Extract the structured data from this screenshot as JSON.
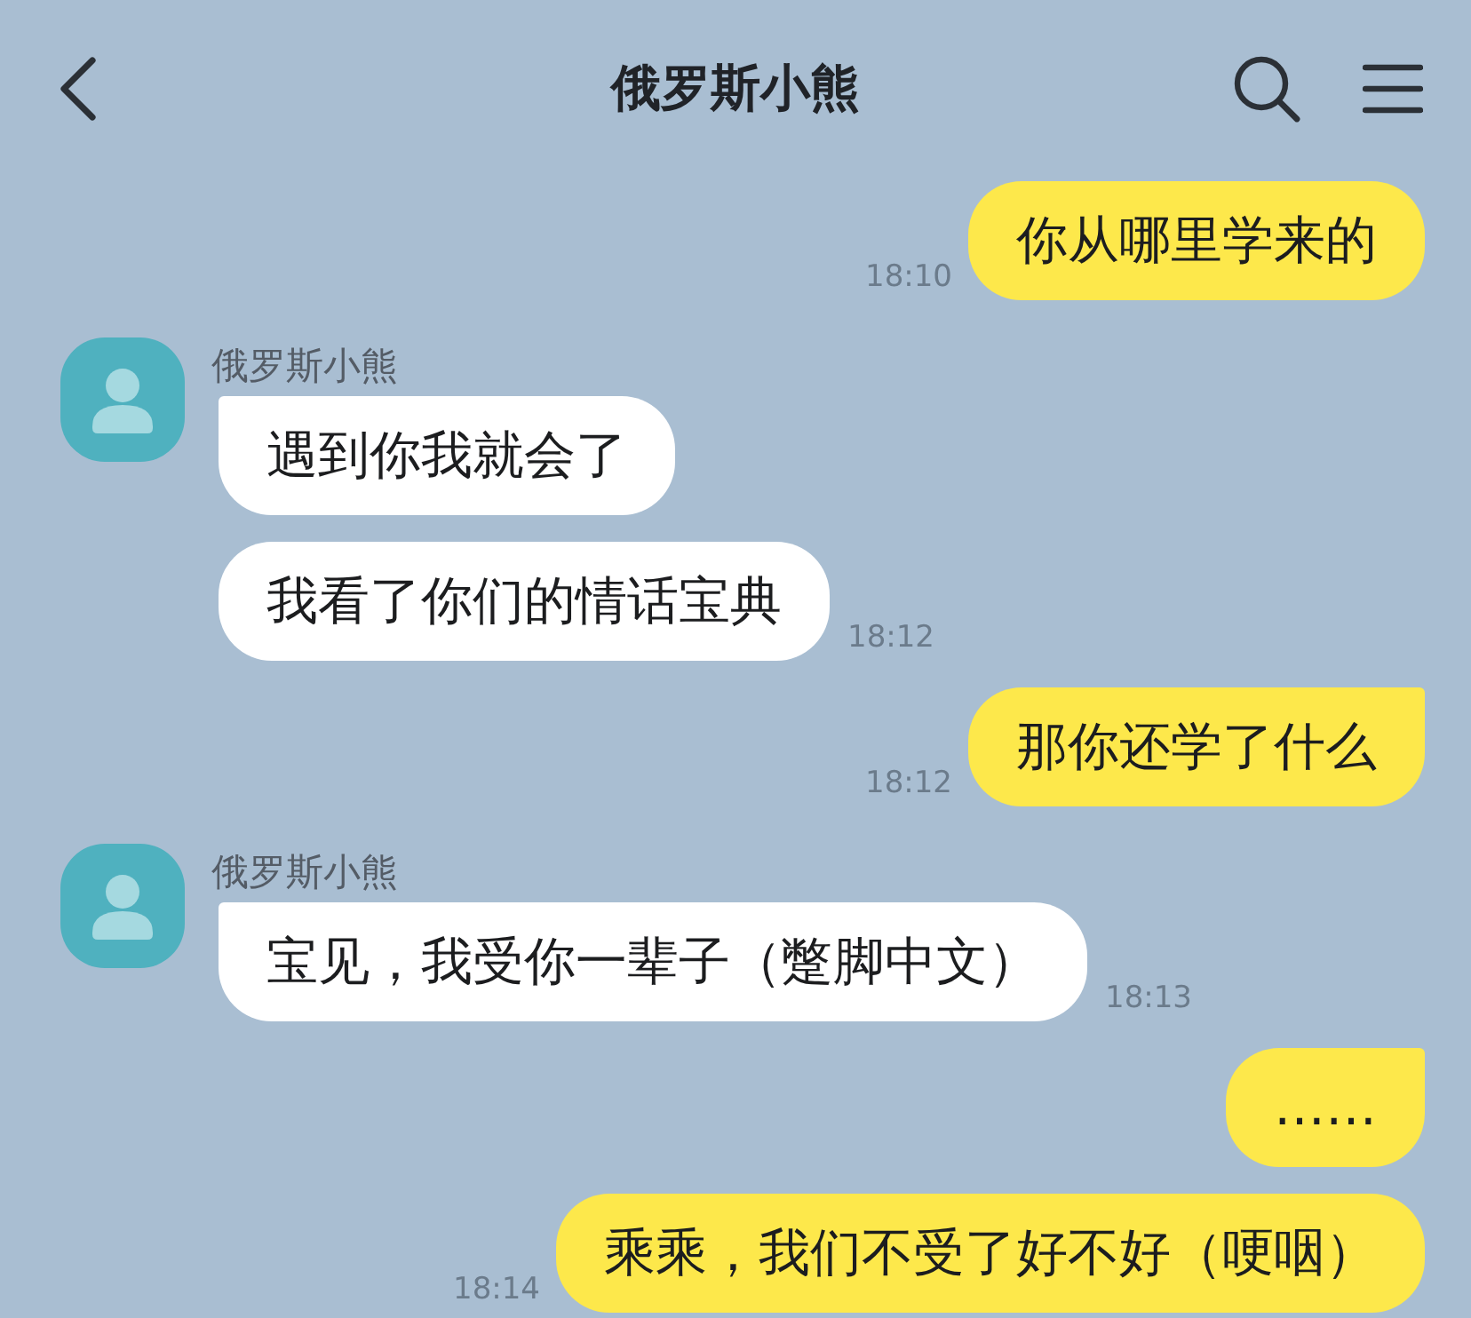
{
  "header": {
    "title": "俄罗斯小熊"
  },
  "messages": [
    {
      "kind": "outgoing",
      "bubbles": [
        {
          "text": "你从哪里学来的",
          "time": "18:10",
          "tail": false
        }
      ]
    },
    {
      "kind": "incoming",
      "sender": "俄罗斯小熊",
      "bubbles": [
        {
          "text": "遇到你我就会了",
          "tail": true
        },
        {
          "text": "我看了你们的情话宝典",
          "time": "18:12",
          "tail": false
        }
      ]
    },
    {
      "kind": "outgoing",
      "bubbles": [
        {
          "text": "那你还学了什么",
          "time": "18:12",
          "tail": true
        }
      ]
    },
    {
      "kind": "incoming",
      "sender": "俄罗斯小熊",
      "bubbles": [
        {
          "text": "宝见，我受你一辈子（蹩脚中文）",
          "time": "18:13",
          "tail": true
        }
      ]
    },
    {
      "kind": "outgoing",
      "bubbles": [
        {
          "text": "……",
          "tail": true
        },
        {
          "text": "乘乘，我们不受了好不好（哽咽）",
          "time": "18:14",
          "tail": false
        }
      ]
    }
  ]
}
